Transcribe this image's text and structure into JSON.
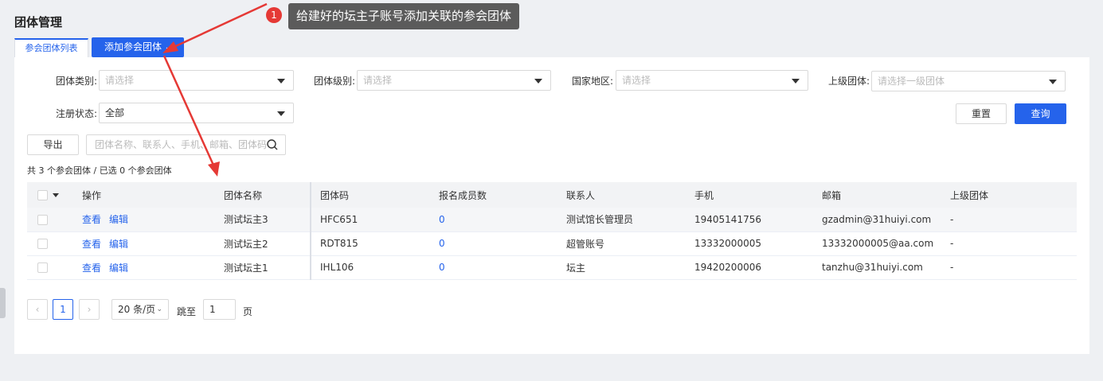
{
  "page": {
    "title": "团体管理"
  },
  "tabs": {
    "list_label": "参会团体列表",
    "add_label": "添加参会团体"
  },
  "filters": {
    "type": {
      "label": "团体类别:",
      "placeholder": "请选择"
    },
    "level": {
      "label": "团体级别:",
      "placeholder": "请选择"
    },
    "region": {
      "label": "国家地区:",
      "placeholder": "请选择"
    },
    "parent": {
      "label": "上级团体:",
      "placeholder": "请选择一级团体"
    },
    "status": {
      "label": "注册状态:",
      "value": "全部"
    }
  },
  "actions": {
    "reset": "重置",
    "query": "查询",
    "export": "导出"
  },
  "search": {
    "placeholder": "团体名称、联系人、手机、邮箱、团体码"
  },
  "summary": "共 3 个参会团体 / 已选 0 个参会团体",
  "table": {
    "headers": [
      "操作",
      "团体名称",
      "团体码",
      "报名成员数",
      "联系人",
      "手机",
      "邮箱",
      "上级团体"
    ],
    "view_label": "查看",
    "edit_label": "编辑",
    "rows": [
      {
        "name": "测试坛主3",
        "code": "HFC651",
        "members": "0",
        "contact": "测试馆长管理员",
        "phone": "19405141756",
        "email": "gzadmin@31huiyi.com",
        "parent": "-"
      },
      {
        "name": "测试坛主2",
        "code": "RDT815",
        "members": "0",
        "contact": "超管账号",
        "phone": "13332000005",
        "email": "13332000005@aa.com",
        "parent": "-"
      },
      {
        "name": "测试坛主1",
        "code": "IHL106",
        "members": "0",
        "contact": "坛主",
        "phone": "19420200006",
        "email": "tanzhu@31huiyi.com",
        "parent": "-"
      }
    ]
  },
  "pagination": {
    "prev": "‹",
    "current": "1",
    "next": "›",
    "page_size": "20 条/页",
    "jump_label": "跳至",
    "jump_value": "1",
    "page_suffix": "页"
  },
  "annotation": {
    "badge": "1",
    "text": "给建好的坛主子账号添加关联的参会团体"
  },
  "colors": {
    "primary": "#2563eb",
    "annotation_red": "#e53935",
    "annotation_bg": "#5b5b5b"
  }
}
